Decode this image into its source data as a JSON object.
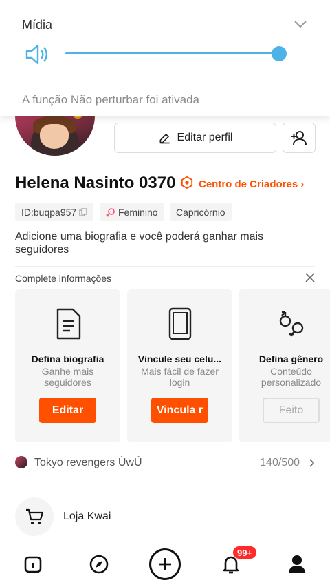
{
  "media_panel": {
    "title": "Mídia",
    "volume_level": 0.95,
    "notice": "A função Não perturbar foi ativada"
  },
  "profile": {
    "edit_label": "Editar perfil",
    "username": "Helena Nasinto 0370",
    "creator_link": "Centro de Criadores",
    "tags": {
      "id": "ID:buqpa957",
      "gender": "Feminino",
      "sign": "Capricórnio"
    },
    "bio": "Adicione uma biografia e você poderá ganhar mais seguidores"
  },
  "complete_info": {
    "label": "Complete informações",
    "cards": [
      {
        "title": "Defina biografia",
        "desc": "Ganhe mais seguidores",
        "button": "Editar",
        "icon": "document-icon"
      },
      {
        "title": "Vincule seu celu...",
        "desc": "Mais fácil de fazer login",
        "button": "Vincula r",
        "icon": "phone-icon"
      },
      {
        "title": "Defina gênero",
        "desc": "Conteúdo personalizado",
        "button": "Feito",
        "icon": "gender-icon"
      }
    ]
  },
  "music": {
    "text": "Tokyo revengers ÙwÚ",
    "count": "140/500"
  },
  "shop": {
    "label": "Loja Kwai"
  },
  "nav": {
    "badge": "99+"
  },
  "colors": {
    "accent": "#ff5000",
    "slider": "#4db3e6",
    "badge": "#ff2a2a"
  }
}
